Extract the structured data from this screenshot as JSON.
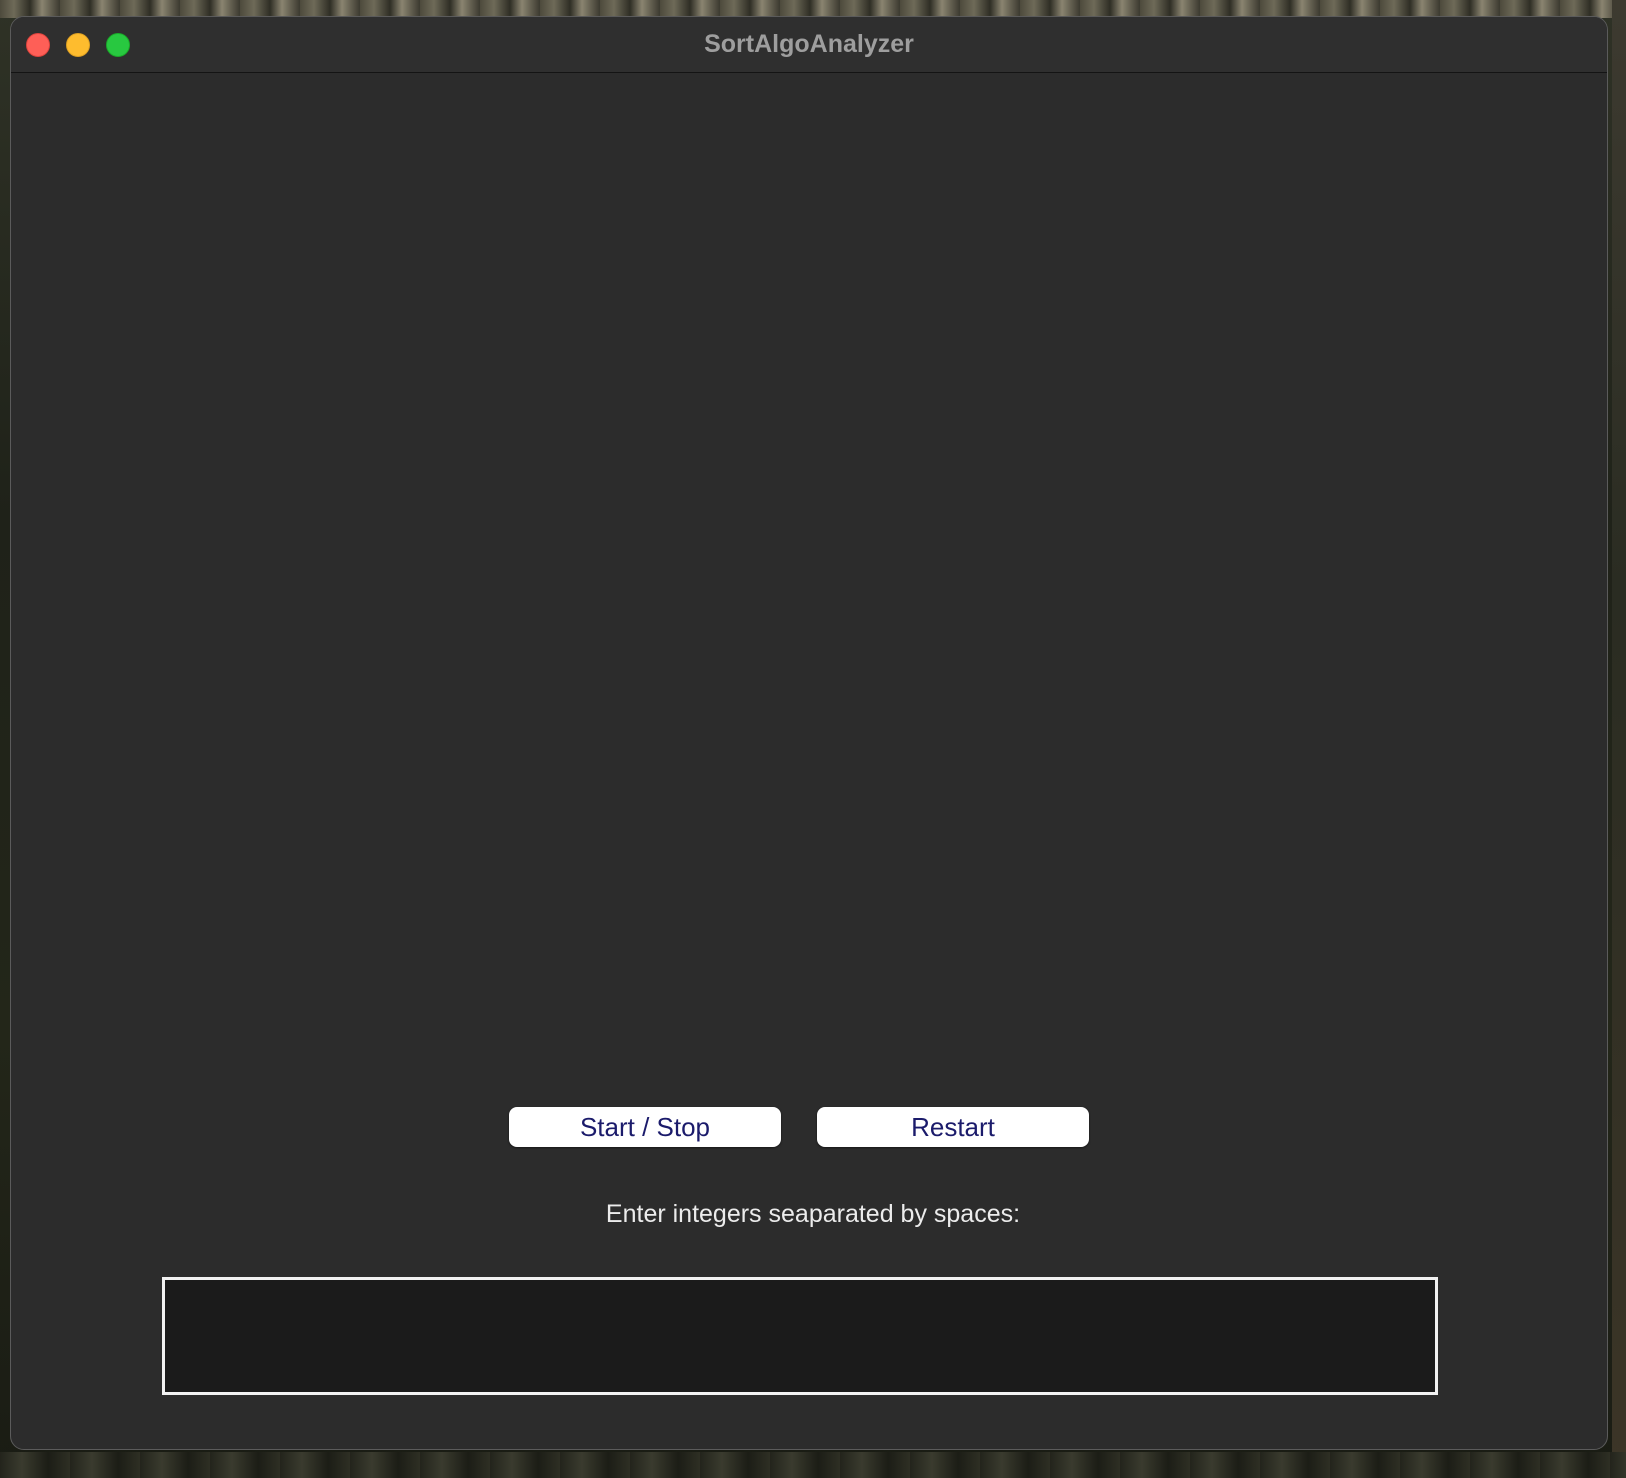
{
  "window": {
    "title": "SortAlgoAnalyzer"
  },
  "controls": {
    "start_stop_label": "Start / Stop",
    "restart_label": "Restart"
  },
  "input_section": {
    "prompt": "Enter integers seaparated by spaces:",
    "value": ""
  },
  "icons": {
    "close": "close-icon",
    "minimize": "minimize-icon",
    "zoom": "zoom-icon"
  },
  "colors": {
    "close": "#fe5f57",
    "minimize": "#febc2e",
    "zoom": "#28c840",
    "window_background": "#2c2c2c",
    "button_background": "#ffffff",
    "button_text": "#1b1b6b",
    "input_background": "#1b1b1b",
    "input_border": "#f2f2f2"
  }
}
